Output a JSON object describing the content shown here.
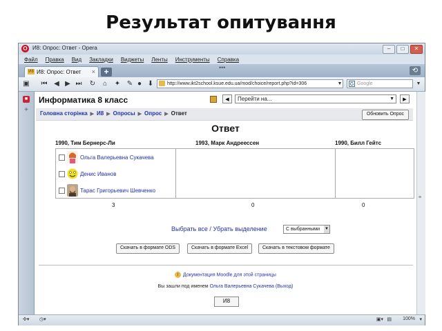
{
  "slide": {
    "title": "Результат опитування"
  },
  "window": {
    "title": "И8: Опрос: Ответ - Opera",
    "min": "–",
    "max": "□",
    "close": "✕"
  },
  "menu": [
    "Файл",
    "Правка",
    "Вид",
    "Закладки",
    "Виджеты",
    "Ленты",
    "Инструменты",
    "Справка"
  ],
  "tab": {
    "label": "И8: Опрос: Ответ",
    "close": "×",
    "new": "+",
    "favicon": "И8"
  },
  "toolbar": {
    "url": "http://www.ikt2school.ksue.edu.ua/mod/choice/report.php?id=306",
    "search_placeholder": "Google",
    "search_icon": "G",
    "dots": "•••"
  },
  "page": {
    "course_title": "Информатика 8 класс",
    "jump_select": "Перейти на...",
    "breadcrumbs": {
      "home": "Головна сторінка",
      "course": "И8",
      "module": "Опросы",
      "activity": "Опрос",
      "current": "Ответ"
    },
    "update_button": "Обновить Опрос",
    "heading": "Ответ",
    "columns": [
      "1990, Тим Бернерс-Ли",
      "1993, Марк Андреессен",
      "1990, Билл Гейтс"
    ],
    "respondents": [
      "Ольга Валерьевна Сукачева",
      "Денис Иванов",
      "Тарас Григорьевич Шевченко"
    ],
    "counts": [
      "3",
      "0",
      "0"
    ],
    "select_all": "Выбрать все / Убрать выделение",
    "bulk_select": "С выбранными",
    "download": {
      "ods": "Скачать в формате ODS",
      "excel": "Скачать в формате Excel",
      "text": "Скачать в текстовом формате"
    },
    "moodle_doc": "Документация Moodle для этой страницы",
    "logged_in_prefix": "Вы зашли под именем",
    "logged_in_user": "Ольга Валерьевна Сукачева",
    "logout": "(Выход)",
    "home_button": "И8"
  },
  "status": {
    "zoom": "100%"
  }
}
